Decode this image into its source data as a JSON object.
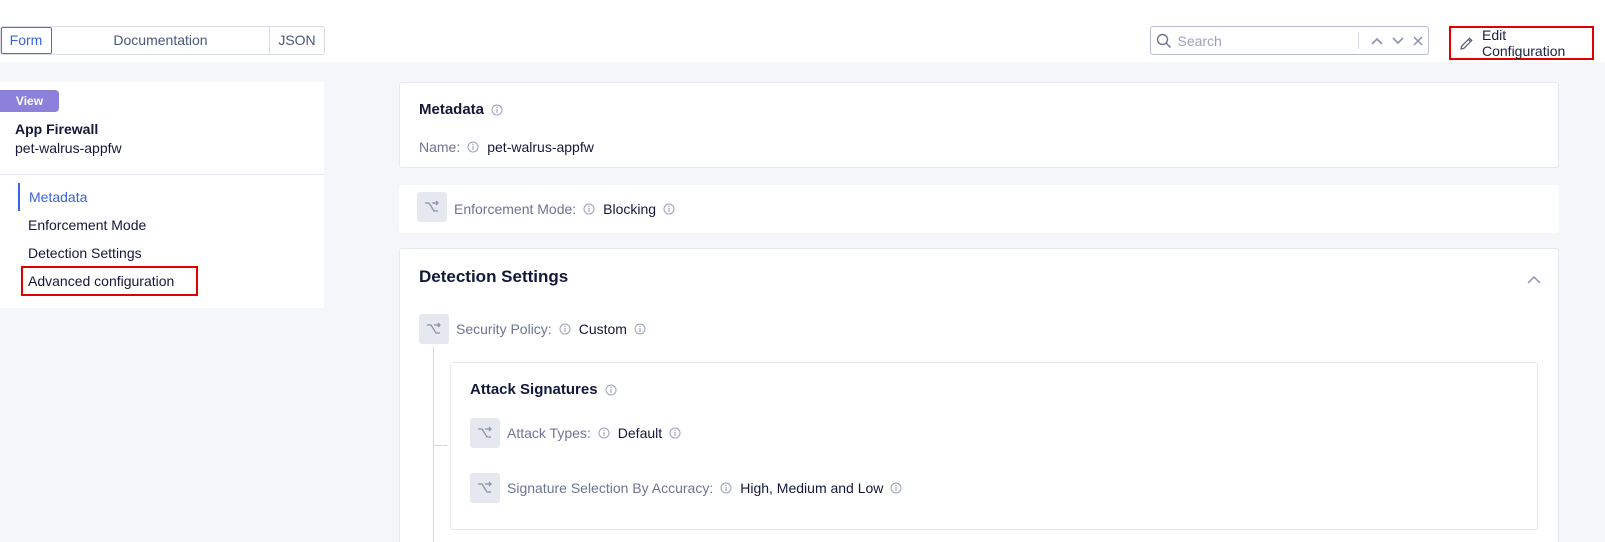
{
  "tabs": [
    {
      "label": "Form",
      "active": true
    },
    {
      "label": "Documentation",
      "active": false
    },
    {
      "label": "JSON",
      "active": false
    }
  ],
  "search": {
    "placeholder": "Search"
  },
  "edit_button": {
    "label": "Edit Configuration"
  },
  "sidebar": {
    "badge": "View",
    "object_type": "App Firewall",
    "object_name": "pet-walrus-appfw",
    "items": [
      {
        "label": "Metadata",
        "active": true
      },
      {
        "label": "Enforcement Mode",
        "active": false
      },
      {
        "label": "Detection Settings",
        "active": false
      },
      {
        "label": "Advanced configuration",
        "active": false,
        "highlighted": true
      }
    ]
  },
  "metadata": {
    "title": "Metadata",
    "name_label": "Name:",
    "name_value": "pet-walrus-appfw"
  },
  "enforcement": {
    "label": "Enforcement Mode:",
    "value": "Blocking"
  },
  "detection": {
    "title": "Detection Settings",
    "security_policy_label": "Security Policy:",
    "security_policy_value": "Custom",
    "attack_signatures": {
      "title": "Attack Signatures",
      "attack_types_label": "Attack Types:",
      "attack_types_value": "Default",
      "accuracy_label": "Signature Selection By Accuracy:",
      "accuracy_value": "High, Medium and Low"
    }
  },
  "colors": {
    "accent": "#3b62e0",
    "badge": "#8b80dc",
    "highlight": "#e00000"
  }
}
